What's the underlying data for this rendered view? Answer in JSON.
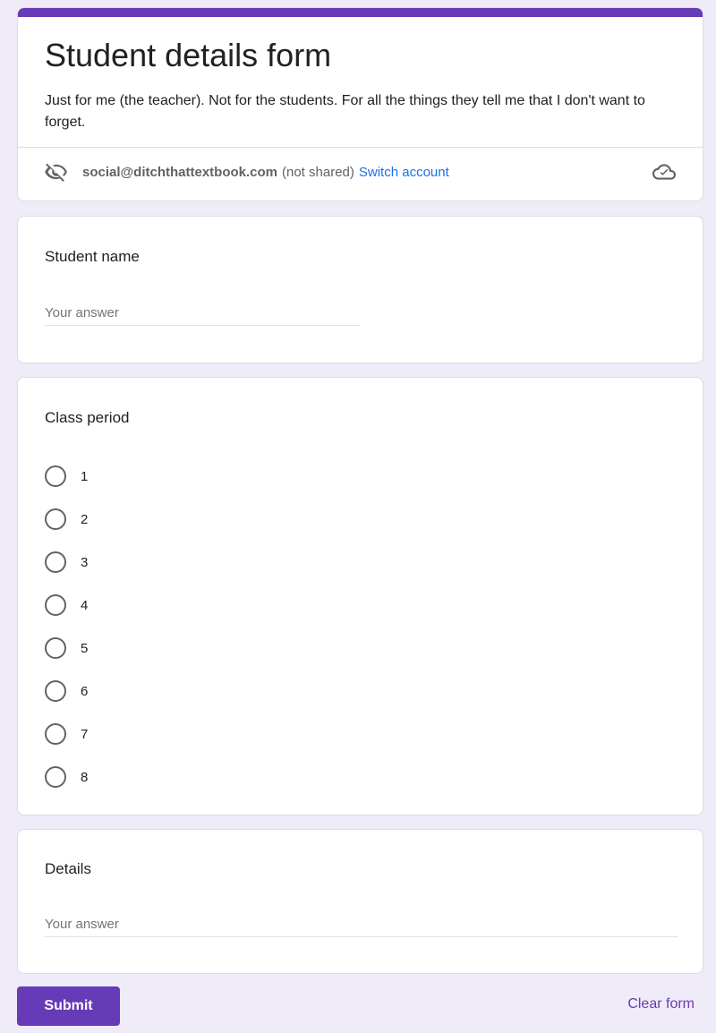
{
  "header": {
    "title": "Student details form",
    "description": "Just for me (the teacher). Not for the students. For all the things they tell me that I don't want to forget.",
    "account_email": "social@ditchthattextbook.com",
    "not_shared": "(not shared)",
    "switch_account": "Switch account",
    "hidden_icon": "eye-off-icon",
    "cloud_icon": "cloud-check-icon"
  },
  "questions": {
    "student_name": {
      "title": "Student name",
      "placeholder": "Your answer",
      "value": ""
    },
    "class_period": {
      "title": "Class period",
      "options": [
        "1",
        "2",
        "3",
        "4",
        "5",
        "6",
        "7",
        "8"
      ]
    },
    "details": {
      "title": "Details",
      "placeholder": "Your answer",
      "value": ""
    }
  },
  "footer": {
    "submit_label": "Submit",
    "clear_label": "Clear form"
  },
  "colors": {
    "accent": "#673ab7",
    "background": "#f0ebf8",
    "link": "#1a73e8"
  }
}
